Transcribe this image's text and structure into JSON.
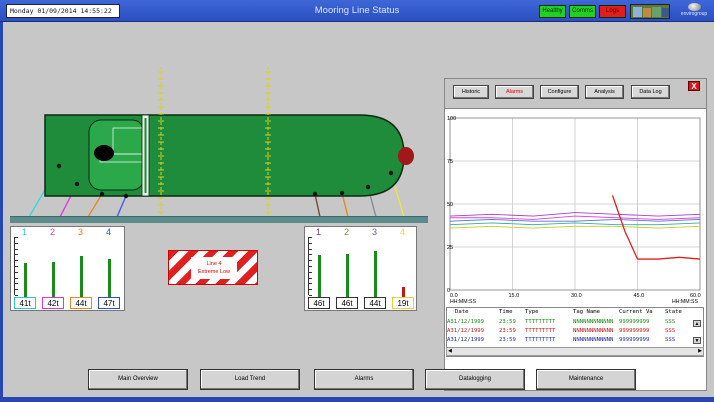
{
  "header": {
    "datetime": "Monday 01/09/2014  14:55:22",
    "title": "Mooring Line Status",
    "status": {
      "healthy": "Healthy",
      "comms": "Comms",
      "logs": "Logs"
    },
    "logo_text": "envirogroup",
    "colors": {
      "bar": "#2a4fc0",
      "healthy": "#22d022",
      "logs": "#e01e1e"
    }
  },
  "ship": {
    "hull_color": "#1e8c3a",
    "hook_indicators": [
      "cyan",
      "magenta",
      "orange",
      "blue",
      "brown",
      "orange",
      "grey",
      "yellow"
    ]
  },
  "left_panel": {
    "numbers": [
      "1",
      "2",
      "3",
      "4"
    ],
    "loads": [
      "41t",
      "42t",
      "44t",
      "47t"
    ],
    "levels": [
      0.58,
      0.6,
      0.7,
      0.65
    ]
  },
  "right_panel": {
    "numbers": [
      "1",
      "2",
      "3",
      "4"
    ],
    "loads": [
      "46t",
      "46t",
      "44t",
      "19t"
    ],
    "levels": [
      0.72,
      0.74,
      0.8,
      0.18
    ]
  },
  "warning": {
    "line1": "Line 4",
    "line2": "Extreme Low"
  },
  "trend": {
    "buttons": [
      "Historic",
      "Alarms",
      "Configure",
      "Analysis",
      "Data Log"
    ],
    "close_label": "X"
  },
  "chart_data": {
    "type": "line",
    "xlabel": "HH:MM:SS",
    "x_ticks": [
      "0.0",
      "15.0",
      "30.0",
      "45.0",
      "60.0"
    ],
    "y_ticks": [
      "100",
      "75",
      "50",
      "25",
      "0"
    ],
    "xlim": [
      0,
      60
    ],
    "ylim": [
      0,
      100
    ],
    "grid": true,
    "series": [
      {
        "color": "#a040d0",
        "x": [
          0,
          10,
          20,
          30,
          40,
          50,
          60
        ],
        "y": [
          43,
          44,
          43,
          45,
          44,
          43,
          44
        ]
      },
      {
        "color": "#e040e0",
        "x": [
          0,
          10,
          20,
          30,
          40,
          50,
          60
        ],
        "y": [
          42,
          42,
          41,
          43,
          42,
          41,
          42
        ]
      },
      {
        "color": "#5b6fd0",
        "x": [
          0,
          10,
          20,
          30,
          40,
          50,
          60
        ],
        "y": [
          40,
          41,
          40,
          40,
          41,
          40,
          41
        ]
      },
      {
        "color": "#30b0a0",
        "x": [
          0,
          10,
          20,
          30,
          40,
          50,
          60
        ],
        "y": [
          38,
          39,
          38,
          39,
          38,
          38,
          39
        ]
      },
      {
        "color": "#c8c830",
        "x": [
          0,
          10,
          20,
          30,
          40,
          50,
          60
        ],
        "y": [
          36,
          37,
          36,
          37,
          37,
          36,
          37
        ]
      },
      {
        "color": "#e02020",
        "x": [
          39,
          42,
          45,
          50,
          55,
          60
        ],
        "y": [
          55,
          34,
          18,
          18,
          19,
          18
        ]
      }
    ]
  },
  "alarm_table": {
    "columns": [
      "Date",
      "Time",
      "Type",
      "Tag Name",
      "Current Va",
      "State"
    ],
    "rows": [
      {
        "date": "A31/12/1999",
        "time": "23:59",
        "type": "TTTTTTTTT",
        "tag": "NNNNNNNNNNNN",
        "value": "999999999",
        "state": "SSS",
        "color": "#1a8a1a"
      },
      {
        "date": "A31/12/1999",
        "time": "23:59",
        "type": "TTTTTTTTT",
        "tag": "NNNNNNNNNNNN",
        "value": "999999999",
        "state": "SSS",
        "color": "#c01818"
      },
      {
        "date": "A31/12/1999",
        "time": "23:59",
        "type": "TTTTTTTTT",
        "tag": "NNNNNNNNNNNN",
        "value": "999999999",
        "state": "SSS",
        "color": "#1a2a9a"
      }
    ]
  },
  "nav": {
    "buttons": [
      "Main Overview",
      "Load Trend",
      "Alarms",
      "Datalogging",
      "Maintenance"
    ]
  }
}
